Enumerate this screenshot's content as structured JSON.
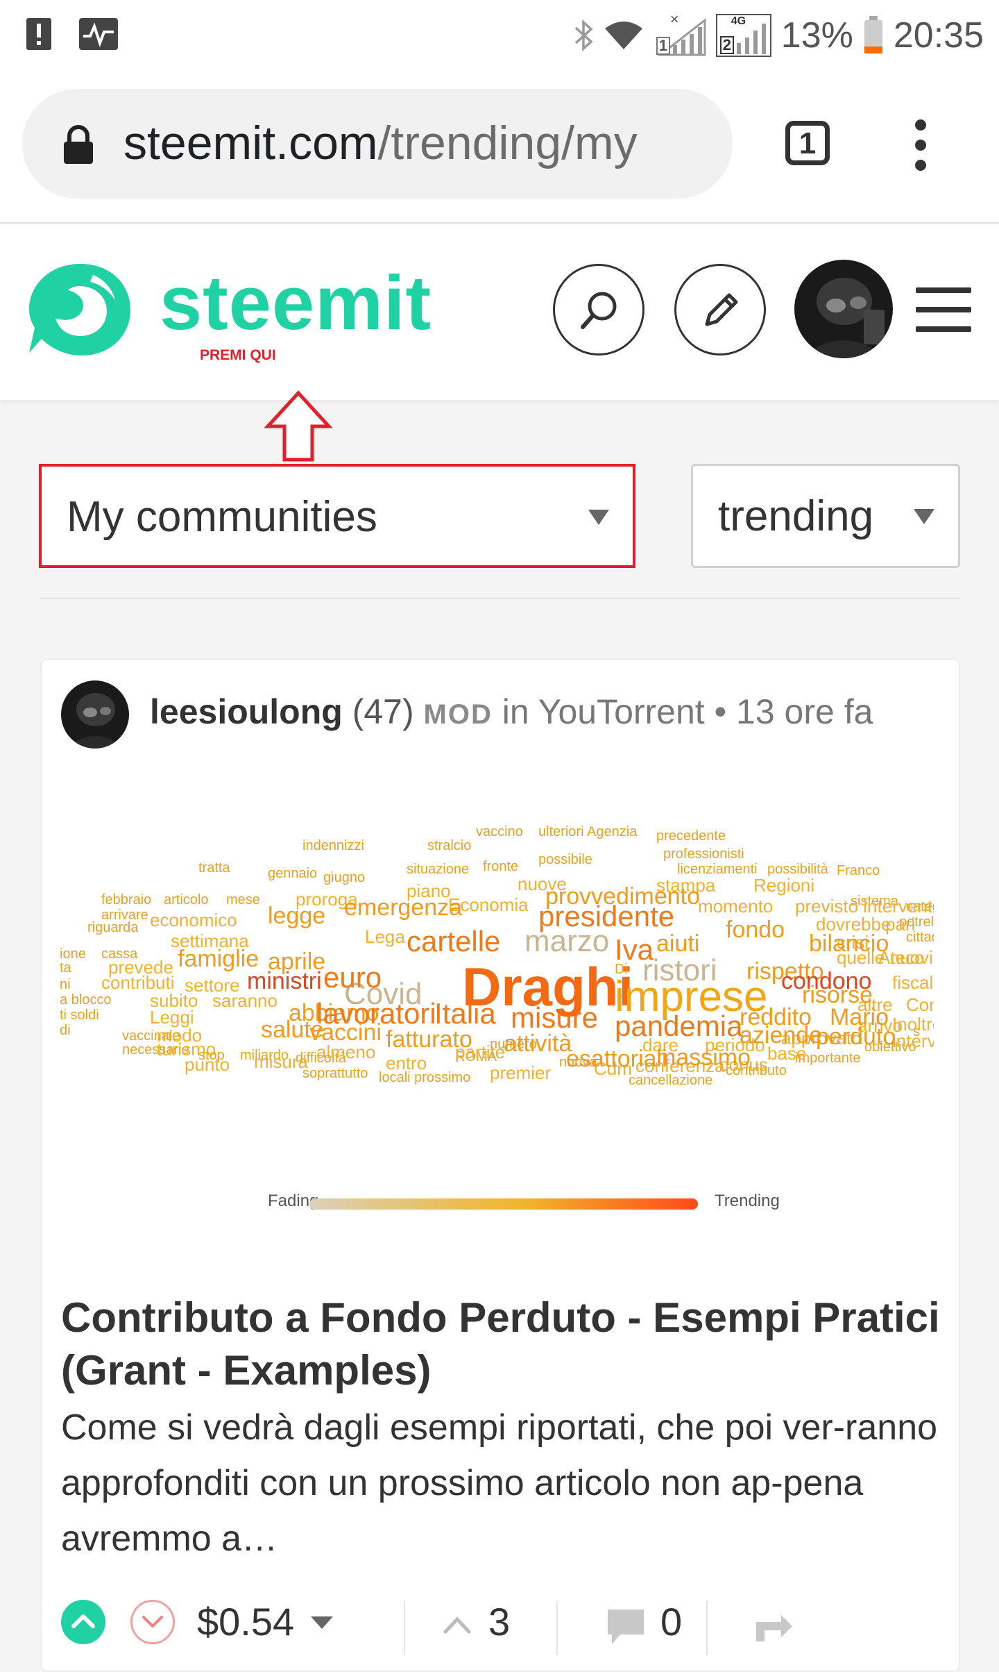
{
  "status_bar": {
    "battery": "13%",
    "time": "20:35",
    "network_badge": "4G",
    "sim1": "1",
    "sim2": "2",
    "icons": [
      "alert-icon",
      "activity-icon",
      "bluetooth-icon",
      "wifi-icon",
      "signal-icon",
      "signal-icon",
      "battery-icon"
    ],
    "battery_color": "#ff6a00"
  },
  "browser": {
    "url_host": "steemit.com",
    "url_path": "/trending/my",
    "tab_count": "1"
  },
  "header": {
    "logo_text": "steemit",
    "annotation": "PREMI QUI",
    "brand_color": "#1fd1a3",
    "annotation_color": "#e0202a"
  },
  "filters": {
    "community": "My communities",
    "sort": "trending"
  },
  "post": {
    "author": "leesioulong",
    "reputation": "(47)",
    "role": "MOD",
    "community_prefix": "in",
    "community": "YouTorrent",
    "separator": "•",
    "time": "13 ore fa",
    "image_legend_left": "Fading",
    "image_legend_right": "Trending",
    "title": "Contributo a Fondo Perduto - Esempi Pratici (Grant - Examples)",
    "excerpt": "Come si vedrà dagli esempi riportati, che poi ver-ranno approfonditi con un prossimo articolo non ap-pena avremmo a…",
    "payout": "$0.54",
    "votes": "3",
    "comments": "0"
  }
}
